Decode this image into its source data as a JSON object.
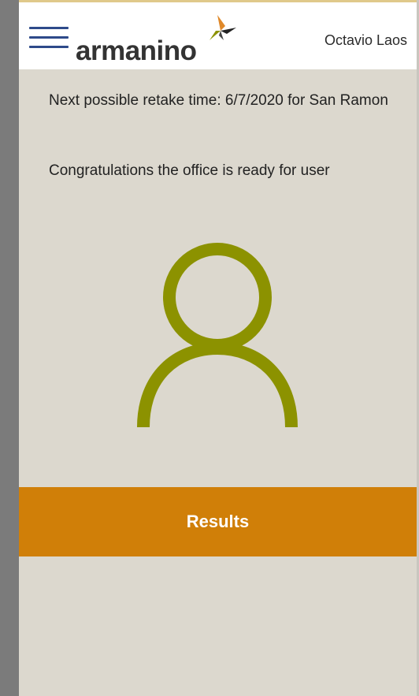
{
  "header": {
    "logo_text": "armanino",
    "user_name": "Octavio Laos"
  },
  "main": {
    "retake_message": "Next possible retake time: 6/7/2020 for San Ramon",
    "status_message": "Congratulations the office is ready for user"
  },
  "actions": {
    "results_label": "Results"
  },
  "colors": {
    "background": "#dcd8ce",
    "accent_orange": "#d07f08",
    "icon_olive": "#8c9200",
    "menu_blue": "#2e4a8a"
  },
  "icons": {
    "menu": "hamburger-menu-icon",
    "avatar": "person-icon",
    "logo_mark": "logo-star-icon"
  }
}
